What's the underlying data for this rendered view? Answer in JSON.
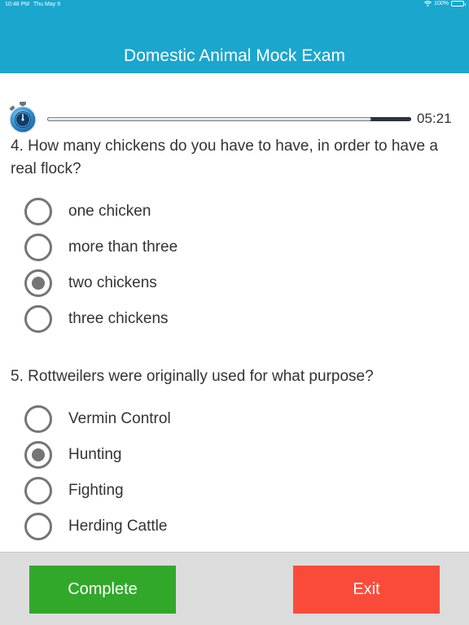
{
  "status_bar": {
    "time": "10:48 PM",
    "date": "Thu May 9",
    "battery": "100%",
    "battery_level": 1.0
  },
  "header": {
    "title": "Domestic Animal Mock Exam",
    "background_color": "#1ba6ce"
  },
  "timer": {
    "icon": "stopwatch-icon",
    "time_remaining": "05:21",
    "progress_fraction": 0.89
  },
  "questions": [
    {
      "text": "4. How many chickens do you have to have, in order to have a real flock?",
      "options": [
        {
          "label": "one chicken",
          "selected": false
        },
        {
          "label": "more than three",
          "selected": false
        },
        {
          "label": "two chickens",
          "selected": true
        },
        {
          "label": "three chickens",
          "selected": false
        }
      ]
    },
    {
      "text": "5. Rottweilers were originally used for what purpose?",
      "options": [
        {
          "label": "Vermin Control",
          "selected": false
        },
        {
          "label": "Hunting",
          "selected": true
        },
        {
          "label": "Fighting",
          "selected": false
        },
        {
          "label": "Herding Cattle",
          "selected": false
        }
      ]
    }
  ],
  "footer": {
    "complete_label": "Complete",
    "exit_label": "Exit",
    "complete_color": "#32a82b",
    "exit_color": "#fa4b3a"
  }
}
